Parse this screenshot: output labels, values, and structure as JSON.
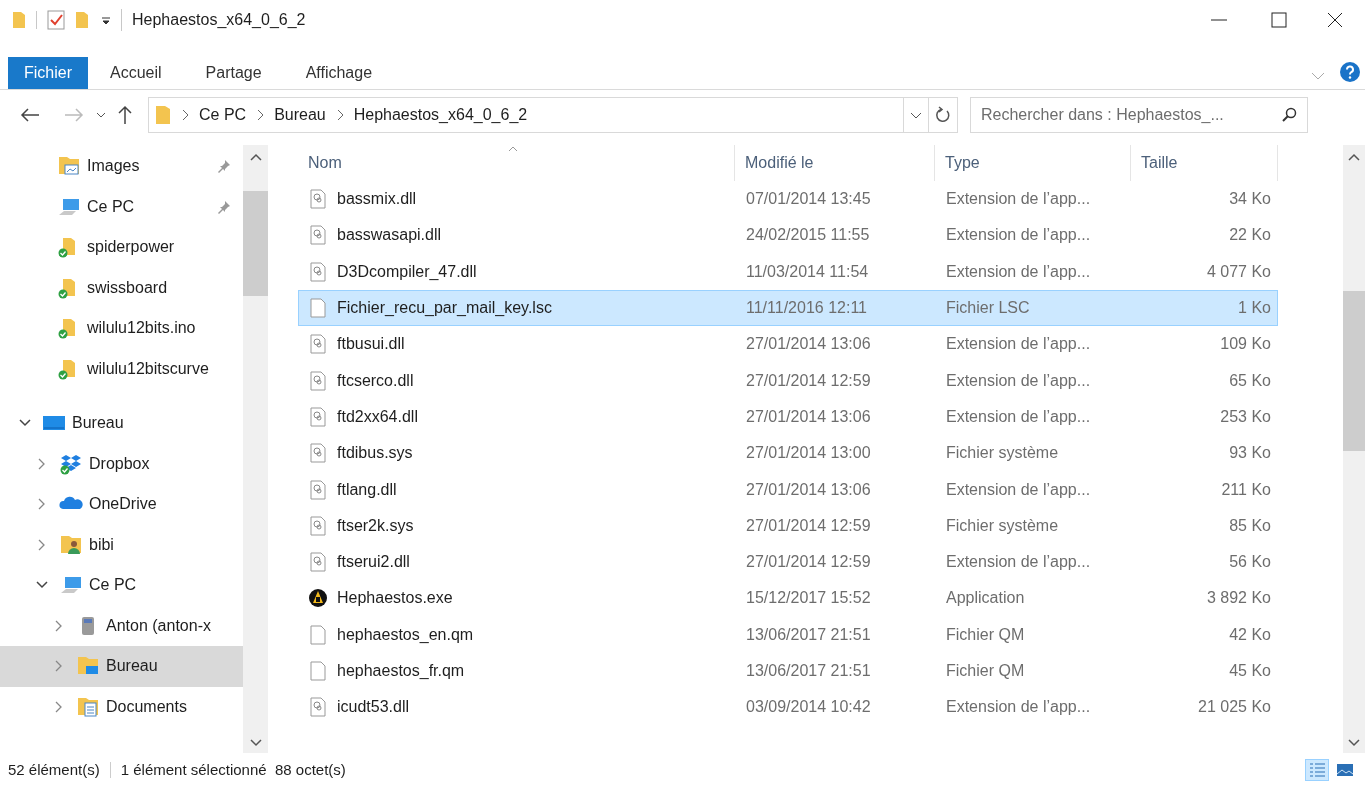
{
  "window": {
    "title": "Hephaestos_x64_0_6_2"
  },
  "ribbon_tabs": [
    {
      "label": "Fichier",
      "selected": true
    },
    {
      "label": "Accueil",
      "selected": false
    },
    {
      "label": "Partage",
      "selected": false
    },
    {
      "label": "Affichage",
      "selected": false
    }
  ],
  "address": {
    "crumbs": [
      "Ce PC",
      "Bureau",
      "Hephaestos_x64_0_6_2"
    ]
  },
  "search": {
    "placeholder": "Rechercher dans : Hephaestos_..."
  },
  "quick_access": [
    {
      "label": "Images",
      "kind": "images",
      "pinned": true
    },
    {
      "label": "Ce PC",
      "kind": "pc",
      "pinned": true
    },
    {
      "label": "spiderpower",
      "kind": "synced",
      "pinned": false
    },
    {
      "label": "swissboard",
      "kind": "synced",
      "pinned": false
    },
    {
      "label": "wilulu12bits.ino",
      "kind": "synced",
      "pinned": false
    },
    {
      "label": "wilulu12bitscurve",
      "kind": "synced",
      "pinned": false
    }
  ],
  "tree": [
    {
      "label": "Bureau",
      "kind": "desktop",
      "expanded": true,
      "selected": false,
      "children": [
        {
          "label": "Dropbox",
          "kind": "dropbox",
          "expanded": false,
          "selected": false
        },
        {
          "label": "OneDrive",
          "kind": "onedrive",
          "expanded": false,
          "selected": false
        },
        {
          "label": "bibi",
          "kind": "user",
          "expanded": false,
          "selected": false
        },
        {
          "label": "Ce PC",
          "kind": "pc",
          "expanded": true,
          "selected": false,
          "children": [
            {
              "label": "Anton (anton-x",
              "kind": "drive",
              "expanded": false,
              "selected": false
            },
            {
              "label": "Bureau",
              "kind": "desktopfolder",
              "expanded": false,
              "selected": true
            },
            {
              "label": "Documents",
              "kind": "documents",
              "expanded": false,
              "selected": false
            }
          ]
        }
      ]
    }
  ],
  "table": {
    "columns": [
      "Nom",
      "Modifié le",
      "Type",
      "Taille"
    ],
    "rows": [
      {
        "name": "bassmix.dll",
        "modified": "07/01/2014 13:45",
        "type": "Extension de l’app...",
        "size": "34 Ko",
        "kind": "dll",
        "selected": false
      },
      {
        "name": "basswasapi.dll",
        "modified": "24/02/2015 11:55",
        "type": "Extension de l’app...",
        "size": "22 Ko",
        "kind": "dll",
        "selected": false
      },
      {
        "name": "D3Dcompiler_47.dll",
        "modified": "11/03/2014 11:54",
        "type": "Extension de l’app...",
        "size": "4 077 Ko",
        "kind": "dll",
        "selected": false
      },
      {
        "name": "Fichier_recu_par_mail_key.lsc",
        "modified": "11/11/2016 12:11",
        "type": "Fichier LSC",
        "size": "1 Ko",
        "kind": "file",
        "selected": true
      },
      {
        "name": "ftbusui.dll",
        "modified": "27/01/2014 13:06",
        "type": "Extension de l’app...",
        "size": "109 Ko",
        "kind": "dll",
        "selected": false
      },
      {
        "name": "ftcserco.dll",
        "modified": "27/01/2014 12:59",
        "type": "Extension de l’app...",
        "size": "65 Ko",
        "kind": "dll",
        "selected": false
      },
      {
        "name": "ftd2xx64.dll",
        "modified": "27/01/2014 13:06",
        "type": "Extension de l’app...",
        "size": "253 Ko",
        "kind": "dll",
        "selected": false
      },
      {
        "name": "ftdibus.sys",
        "modified": "27/01/2014 13:00",
        "type": "Fichier système",
        "size": "93 Ko",
        "kind": "dll",
        "selected": false
      },
      {
        "name": "ftlang.dll",
        "modified": "27/01/2014 13:06",
        "type": "Extension de l’app...",
        "size": "211 Ko",
        "kind": "dll",
        "selected": false
      },
      {
        "name": "ftser2k.sys",
        "modified": "27/01/2014 12:59",
        "type": "Fichier système",
        "size": "85 Ko",
        "kind": "dll",
        "selected": false
      },
      {
        "name": "ftserui2.dll",
        "modified": "27/01/2014 12:59",
        "type": "Extension de l’app...",
        "size": "56 Ko",
        "kind": "dll",
        "selected": false
      },
      {
        "name": "Hephaestos.exe",
        "modified": "15/12/2017 15:52",
        "type": "Application",
        "size": "3 892 Ko",
        "kind": "app",
        "selected": false
      },
      {
        "name": "hephaestos_en.qm",
        "modified": "13/06/2017 21:51",
        "type": "Fichier QM",
        "size": "42 Ko",
        "kind": "file",
        "selected": false
      },
      {
        "name": "hephaestos_fr.qm",
        "modified": "13/06/2017 21:51",
        "type": "Fichier QM",
        "size": "45 Ko",
        "kind": "file",
        "selected": false
      },
      {
        "name": "icudt53.dll",
        "modified": "03/09/2014 10:42",
        "type": "Extension de l’app...",
        "size": "21 025 Ko",
        "kind": "dll",
        "selected": false
      }
    ]
  },
  "status_bar": {
    "count": "52 élément(s)",
    "selection": "1 élément sélectionné  88 octet(s)"
  },
  "view_buttons": [
    {
      "kind": "details",
      "selected": true
    },
    {
      "kind": "tiles",
      "selected": false
    }
  ]
}
